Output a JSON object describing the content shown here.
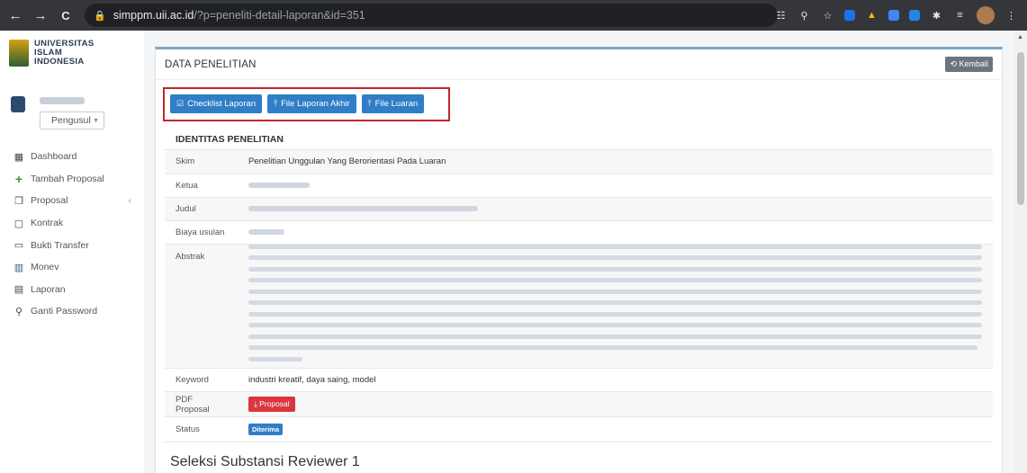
{
  "browser": {
    "back_icon": "←",
    "forward_icon": "→",
    "reload_icon": "C",
    "url_host": "simppm.uii.ac.id",
    "url_path": "/?p=peneliti-detail-laporan&id=351"
  },
  "brand": {
    "line1": "UNIVERSITAS",
    "line2": "ISLAM",
    "line3": "INDONESIA"
  },
  "user": {
    "role_selected": "Pengusul"
  },
  "sidebar": {
    "items": [
      {
        "label": "Dashboard",
        "icon": "▦"
      },
      {
        "label": "Tambah Proposal",
        "icon": "+"
      },
      {
        "label": "Proposal",
        "icon": "❐"
      },
      {
        "label": "Kontrak",
        "icon": "▢"
      },
      {
        "label": "Bukti Transfer",
        "icon": "▭"
      },
      {
        "label": "Monev",
        "icon": "▥"
      },
      {
        "label": "Laporan",
        "icon": "▤"
      },
      {
        "label": "Ganti Password",
        "icon": "⚲"
      }
    ]
  },
  "panel": {
    "title": "DATA PENELITIAN",
    "back_label": "Kembali",
    "actions": {
      "checklist": "Checklist Laporan",
      "file_laporan": "File Laporan Akhir",
      "file_luaran": "File Luaran"
    },
    "section_title": "IDENTITAS PENELITIAN",
    "rows": {
      "skim_label": "Skim",
      "skim_value": "Penelitian Unggulan Yang Berorientasi Pada Luaran",
      "ketua_label": "Ketua",
      "judul_label": "Judul",
      "biaya_label": "Biaya usulan",
      "abstrak_label": "Abstrak",
      "keyword_label": "Keyword",
      "keyword_value": "industri kreatif, daya saing, model",
      "pdf_label": "PDF Proposal",
      "pdf_button": "Proposal",
      "status_label": "Status",
      "status_value": "Diterima"
    },
    "subheading": "Seleksi Substansi Reviewer 1"
  },
  "colors": {
    "primary": "#2f7ec6",
    "danger": "#d9363e",
    "highlight_border": "#c0272d"
  }
}
